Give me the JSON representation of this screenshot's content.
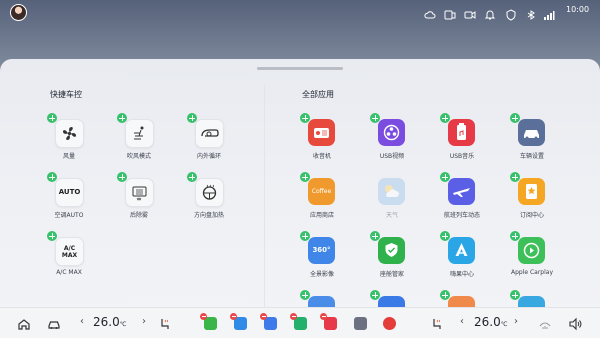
{
  "status_bar": {
    "time": "10:00",
    "icons": [
      "cloud-icon",
      "phone-screen-icon",
      "video-icon",
      "bell-icon",
      "shield-icon",
      "bluetooth-icon",
      "cellular-signal-icon"
    ]
  },
  "panel": {
    "left_title": "快捷车控",
    "right_title": "全部应用",
    "controls": [
      {
        "label": "风量",
        "icon": "fan-icon"
      },
      {
        "label": "吹风模式",
        "icon": "airflow-mode-icon"
      },
      {
        "label": "内外循环",
        "icon": "recirculation-icon"
      },
      {
        "label": "空调AUTO",
        "icon": "auto-text-icon",
        "text": "AUTO"
      },
      {
        "label": "后除雾",
        "icon": "rear-defrost-icon"
      },
      {
        "label": "方向盘加热",
        "icon": "steering-heat-icon"
      },
      {
        "label": "A/C MAX",
        "icon": "ac-max-icon",
        "text1": "A/C",
        "text2": "MAX"
      }
    ],
    "apps": [
      {
        "label": "收音机",
        "icon": "radio-icon",
        "color": "#e8493d"
      },
      {
        "label": "USB视频",
        "icon": "usb-video-icon",
        "color": "#7a4de0"
      },
      {
        "label": "USB音乐",
        "icon": "usb-music-icon",
        "color": "#e63b46"
      },
      {
        "label": "车辆设置",
        "icon": "car-settings-icon",
        "color": "#5a6f9a"
      },
      {
        "label": "应用商店",
        "icon": "app-store-icon",
        "color": "#f09a2e",
        "text": "Coffee"
      },
      {
        "label": "天气",
        "icon": "weather-icon",
        "color": "#9fc4ea"
      },
      {
        "label": "航班列车动态",
        "icon": "flight-icon",
        "color": "#5a5fe6"
      },
      {
        "label": "订阅中心",
        "icon": "subscription-icon",
        "color": "#f5a623"
      },
      {
        "label": "全景影像",
        "icon": "panorama-icon",
        "color": "#3f86e8",
        "text": "360°"
      },
      {
        "label": "座舱管家",
        "icon": "cabin-guard-icon",
        "color": "#2fb14c"
      },
      {
        "label": "嗨果中心",
        "icon": "app-center-icon",
        "color": "#2aa6e6"
      },
      {
        "label": "Apple Carplay",
        "icon": "carplay-icon",
        "color": "#3dc05a"
      }
    ]
  },
  "dock": {
    "left_temp": "26.0",
    "right_temp": "26.0",
    "temp_unit": "℃",
    "apps": [
      {
        "icon": "phone-app-icon",
        "color": "#3ab54a"
      },
      {
        "icon": "navigation-app-icon",
        "color": "#2f8be6"
      },
      {
        "icon": "cloud-app-icon",
        "color": "#3f7be8"
      },
      {
        "icon": "bolt-app-icon",
        "color": "#23b06a"
      },
      {
        "icon": "music-app-icon",
        "color": "#e6394a"
      },
      {
        "icon": "grid-app-icon",
        "color": "#6b7180"
      },
      {
        "icon": "netease-app-icon",
        "color": "#e43b3b"
      }
    ]
  }
}
